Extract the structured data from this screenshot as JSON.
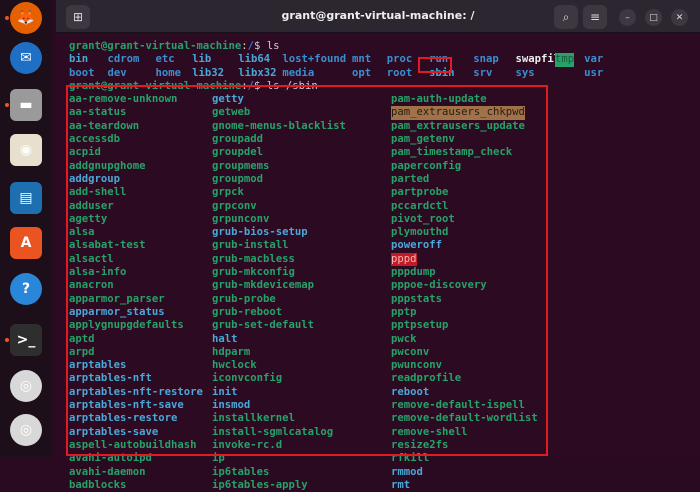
{
  "window": {
    "title": "grant@grant-virtual-machine: /"
  },
  "dock": {
    "items": [
      {
        "name": "firefox-icon",
        "running": true
      },
      {
        "name": "thunderbird-icon",
        "running": false
      },
      {
        "name": "files-icon",
        "running": true
      },
      {
        "name": "rhythmbox-icon",
        "running": false
      },
      {
        "name": "libreoffice-writer-icon",
        "running": false
      },
      {
        "name": "software-center-icon",
        "running": false
      },
      {
        "name": "help-icon",
        "running": false
      },
      {
        "name": "terminal-icon",
        "running": true
      },
      {
        "name": "disc-icon",
        "running": false
      },
      {
        "name": "disc-icon",
        "running": false
      }
    ]
  },
  "terminal": {
    "prompt_user": "grant@grant-virtual-machine",
    "prompt_path": "/",
    "prompt_sym": "$ ",
    "cmd1": "ls",
    "cmd2": "ls /sbin",
    "ls_rows": [
      [
        [
          "bin",
          "cy"
        ],
        [
          "cdrom",
          "b"
        ],
        [
          "etc",
          "b"
        ],
        [
          "lib",
          "cy"
        ],
        [
          "lib64",
          "cy"
        ],
        [
          "lost+found",
          "b"
        ],
        [
          "mnt",
          "b"
        ],
        [
          "proc",
          "b"
        ],
        [
          "run",
          "b"
        ],
        [
          "snap",
          "b"
        ],
        [
          "swapfile",
          "w"
        ],
        [
          "tmp",
          "tmp"
        ],
        [
          "var",
          "b"
        ]
      ],
      [
        [
          "boot",
          "b"
        ],
        [
          "dev",
          "b"
        ],
        [
          "home",
          "b"
        ],
        [
          "lib32",
          "cy"
        ],
        [
          "libx32",
          "cy"
        ],
        [
          "media",
          "b"
        ],
        [
          "opt",
          "b"
        ],
        [
          "root",
          "b"
        ],
        [
          "sbin",
          "cy"
        ],
        [
          "srv",
          "b"
        ],
        [
          "sys",
          "b"
        ],
        [
          "usr",
          "b"
        ]
      ]
    ],
    "sbin": [
      [
        [
          "aa-remove-unknown",
          "g"
        ],
        [
          "getty",
          "cy"
        ],
        [
          "pam-auth-update",
          "g"
        ]
      ],
      [
        [
          "aa-status",
          "g"
        ],
        [
          "getweb",
          "g"
        ],
        [
          "pam_extrausers_chkpwd",
          "hl1"
        ]
      ],
      [
        [
          "aa-teardown",
          "g"
        ],
        [
          "gnome-menus-blacklist",
          "g"
        ],
        [
          "pam_extrausers_update",
          "g"
        ]
      ],
      [
        [
          "accessdb",
          "g"
        ],
        [
          "groupadd",
          "g"
        ],
        [
          "pam_getenv",
          "g"
        ]
      ],
      [
        [
          "acpid",
          "g"
        ],
        [
          "groupdel",
          "g"
        ],
        [
          "pam_timestamp_check",
          "g"
        ]
      ],
      [
        [
          "addgnupghome",
          "g"
        ],
        [
          "groupmems",
          "g"
        ],
        [
          "paperconfig",
          "g"
        ]
      ],
      [
        [
          "addgroup",
          "cy"
        ],
        [
          "groupmod",
          "g"
        ],
        [
          "parted",
          "g"
        ]
      ],
      [
        [
          "add-shell",
          "g"
        ],
        [
          "grpck",
          "g"
        ],
        [
          "partprobe",
          "g"
        ]
      ],
      [
        [
          "adduser",
          "g"
        ],
        [
          "grpconv",
          "g"
        ],
        [
          "pccardctl",
          "g"
        ]
      ],
      [
        [
          "agetty",
          "g"
        ],
        [
          "grpunconv",
          "g"
        ],
        [
          "pivot_root",
          "g"
        ]
      ],
      [
        [
          "alsa",
          "g"
        ],
        [
          "grub-bios-setup",
          "cy"
        ],
        [
          "plymouthd",
          "g"
        ]
      ],
      [
        [
          "alsabat-test",
          "g"
        ],
        [
          "grub-install",
          "g"
        ],
        [
          "poweroff",
          "cy"
        ]
      ],
      [
        [
          "alsactl",
          "g"
        ],
        [
          "grub-macbless",
          "g"
        ],
        [
          "pppd",
          "hl2"
        ]
      ],
      [
        [
          "alsa-info",
          "g"
        ],
        [
          "grub-mkconfig",
          "g"
        ],
        [
          "pppdump",
          "g"
        ]
      ],
      [
        [
          "anacron",
          "g"
        ],
        [
          "grub-mkdevicemap",
          "g"
        ],
        [
          "pppoe-discovery",
          "g"
        ]
      ],
      [
        [
          "apparmor_parser",
          "g"
        ],
        [
          "grub-probe",
          "g"
        ],
        [
          "pppstats",
          "g"
        ]
      ],
      [
        [
          "apparmor_status",
          "cy"
        ],
        [
          "grub-reboot",
          "g"
        ],
        [
          "pptp",
          "g"
        ]
      ],
      [
        [
          "applygnupgdefaults",
          "g"
        ],
        [
          "grub-set-default",
          "g"
        ],
        [
          "pptpsetup",
          "g"
        ]
      ],
      [
        [
          "aptd",
          "g"
        ],
        [
          "halt",
          "cy"
        ],
        [
          "pwck",
          "g"
        ]
      ],
      [
        [
          "arpd",
          "g"
        ],
        [
          "hdparm",
          "g"
        ],
        [
          "pwconv",
          "g"
        ]
      ],
      [
        [
          "arptables",
          "cy"
        ],
        [
          "hwclock",
          "g"
        ],
        [
          "pwunconv",
          "g"
        ]
      ],
      [
        [
          "arptables-nft",
          "cy"
        ],
        [
          "iconvconfig",
          "g"
        ],
        [
          "readprofile",
          "g"
        ]
      ],
      [
        [
          "arptables-nft-restore",
          "cy"
        ],
        [
          "init",
          "cy"
        ],
        [
          "reboot",
          "cy"
        ]
      ],
      [
        [
          "arptables-nft-save",
          "cy"
        ],
        [
          "insmod",
          "cy"
        ],
        [
          "remove-default-ispell",
          "g"
        ]
      ],
      [
        [
          "arptables-restore",
          "cy"
        ],
        [
          "installkernel",
          "g"
        ],
        [
          "remove-default-wordlist",
          "g"
        ]
      ],
      [
        [
          "arptables-save",
          "cy"
        ],
        [
          "install-sgmlcatalog",
          "g"
        ],
        [
          "remove-shell",
          "g"
        ]
      ],
      [
        [
          "aspell-autobuildhash",
          "g"
        ],
        [
          "invoke-rc.d",
          "g"
        ],
        [
          "resize2fs",
          "g"
        ]
      ],
      [
        [
          "avahi-autoipd",
          "g"
        ],
        [
          "ip",
          "g"
        ],
        [
          "rfkill",
          "g"
        ]
      ],
      [
        [
          "avahi-daemon",
          "g"
        ],
        [
          "ip6tables",
          "g"
        ],
        [
          "rmmod",
          "cy"
        ]
      ],
      [
        [
          "badblocks",
          "g"
        ],
        [
          "ip6tables-apply",
          "g"
        ],
        [
          "rmt",
          "cy"
        ]
      ]
    ]
  },
  "colors": {
    "highlight_box": "#e01b24",
    "background": "#2c0a22",
    "accent": "#e95420"
  }
}
